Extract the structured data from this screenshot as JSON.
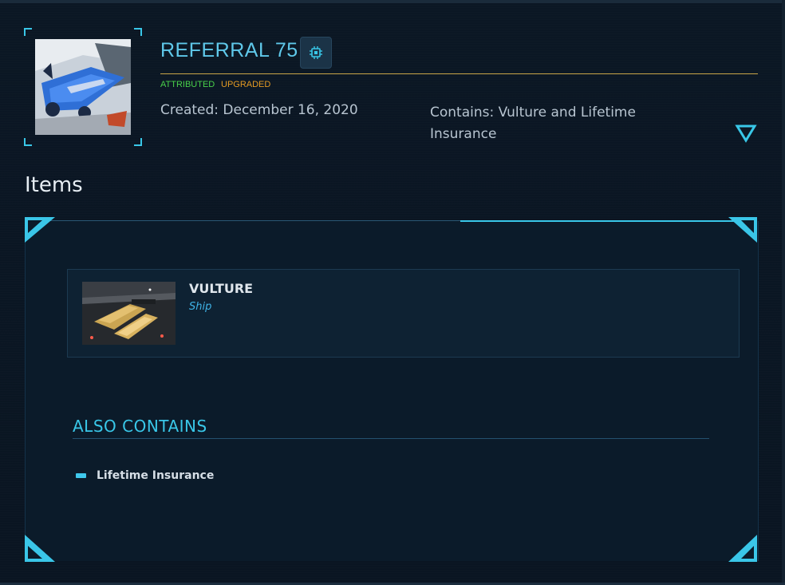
{
  "pledge": {
    "title": "REFERRAL 75",
    "tags": {
      "attributed": "ATTRIBUTED",
      "upgraded": "UPGRADED"
    },
    "created": "Created: December 16, 2020",
    "contains": "Contains: Vulture and Lifetime Insurance",
    "chip_icon": "chip-icon",
    "toggle_icon": "triangle-down-icon"
  },
  "items_section": {
    "heading": "Items",
    "items": [
      {
        "name": "VULTURE",
        "type": "Ship"
      }
    ]
  },
  "also_contains": {
    "heading": "ALSO CONTAINS",
    "items": [
      "Lifetime Insurance"
    ]
  },
  "colors": {
    "accent": "#39c7e8",
    "title": "#5fc8ea",
    "attributed": "#49d14a",
    "upgraded": "#e39a23",
    "rule": "#c9a447"
  }
}
